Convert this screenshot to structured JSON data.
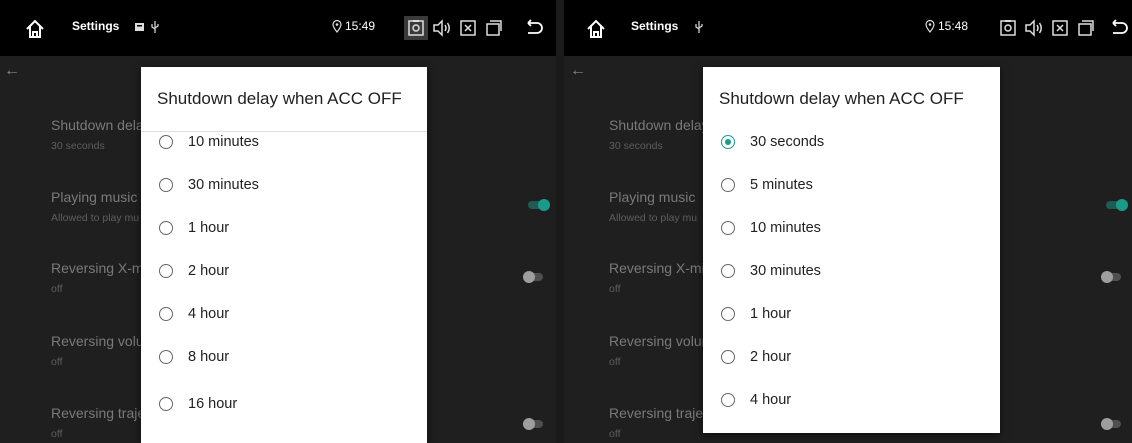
{
  "colors": {
    "accent": "#1a9b8a",
    "toggle_on_track": "#1d5c52",
    "toggle_off_knob": "#9e9e9e",
    "toggle_off_track": "#4f4f4f"
  },
  "left": {
    "status": {
      "title": "Settings",
      "time": "15:49",
      "left_icons": [
        "notification-icon",
        "usb-icon"
      ]
    },
    "settings": [
      {
        "title": "Shutdown delay",
        "subtitle": "30 seconds"
      },
      {
        "title": "Playing music",
        "subtitle": "Allowed to play mu",
        "toggle": "on"
      },
      {
        "title": "Reversing X-mirr",
        "subtitle": "off",
        "toggle": "off"
      },
      {
        "title": "Reversing volum",
        "subtitle": "off"
      },
      {
        "title": "Reversing traject",
        "subtitle": "off",
        "toggle": "off"
      }
    ],
    "dialog": {
      "title": "Shutdown delay when ACC OFF",
      "options": [
        "10 minutes",
        "30 minutes",
        "1 hour",
        "2 hour",
        "4 hour",
        "8 hour",
        "16 hour"
      ],
      "selected": null
    }
  },
  "right": {
    "status": {
      "title": "Settings",
      "time": "15:48",
      "left_icons": [
        "usb-icon"
      ]
    },
    "settings": [
      {
        "title": "Shutdown delay",
        "subtitle": "30 seconds"
      },
      {
        "title": "Playing music",
        "subtitle": "Allowed to play mu",
        "toggle": "on"
      },
      {
        "title": "Reversing X-mirr",
        "subtitle": "off",
        "toggle": "off"
      },
      {
        "title": "Reversing volum",
        "subtitle": "off"
      },
      {
        "title": "Reversing traject",
        "subtitle": "off",
        "toggle": "off"
      }
    ],
    "dialog": {
      "title": "Shutdown delay when ACC OFF",
      "options": [
        "30 seconds",
        "5 minutes",
        "10 minutes",
        "30 minutes",
        "1 hour",
        "2 hour",
        "4 hour"
      ],
      "selected": 0
    }
  }
}
